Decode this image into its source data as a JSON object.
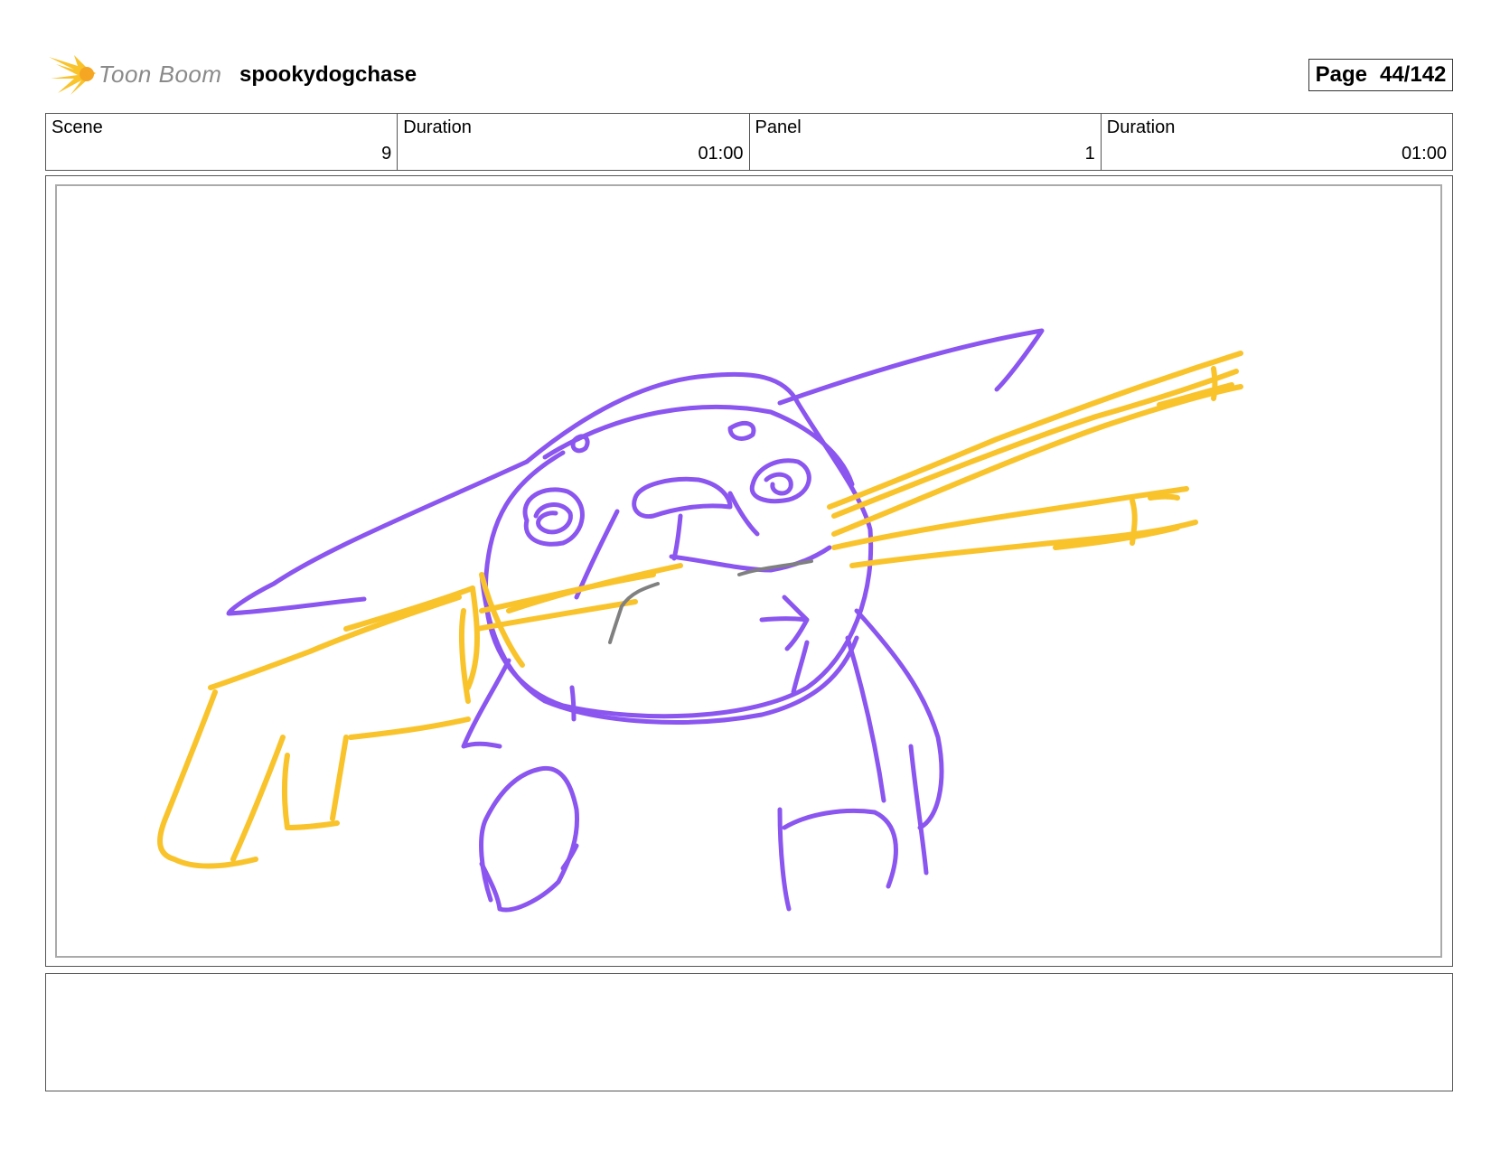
{
  "header": {
    "logo_text": "Toon Boom",
    "project_title": "spookydogchase",
    "page_label": "Page",
    "page_number": "44/142"
  },
  "info": [
    {
      "label": "Scene",
      "value": "9"
    },
    {
      "label": "Duration",
      "value": "01:00"
    },
    {
      "label": "Panel",
      "value": "1"
    },
    {
      "label": "Duration",
      "value": "01:00"
    }
  ],
  "panel": {
    "sketch_colors": {
      "character": "#8b55f0",
      "motion": "#f9c32b",
      "mouth": "#808080"
    }
  },
  "notes": {}
}
